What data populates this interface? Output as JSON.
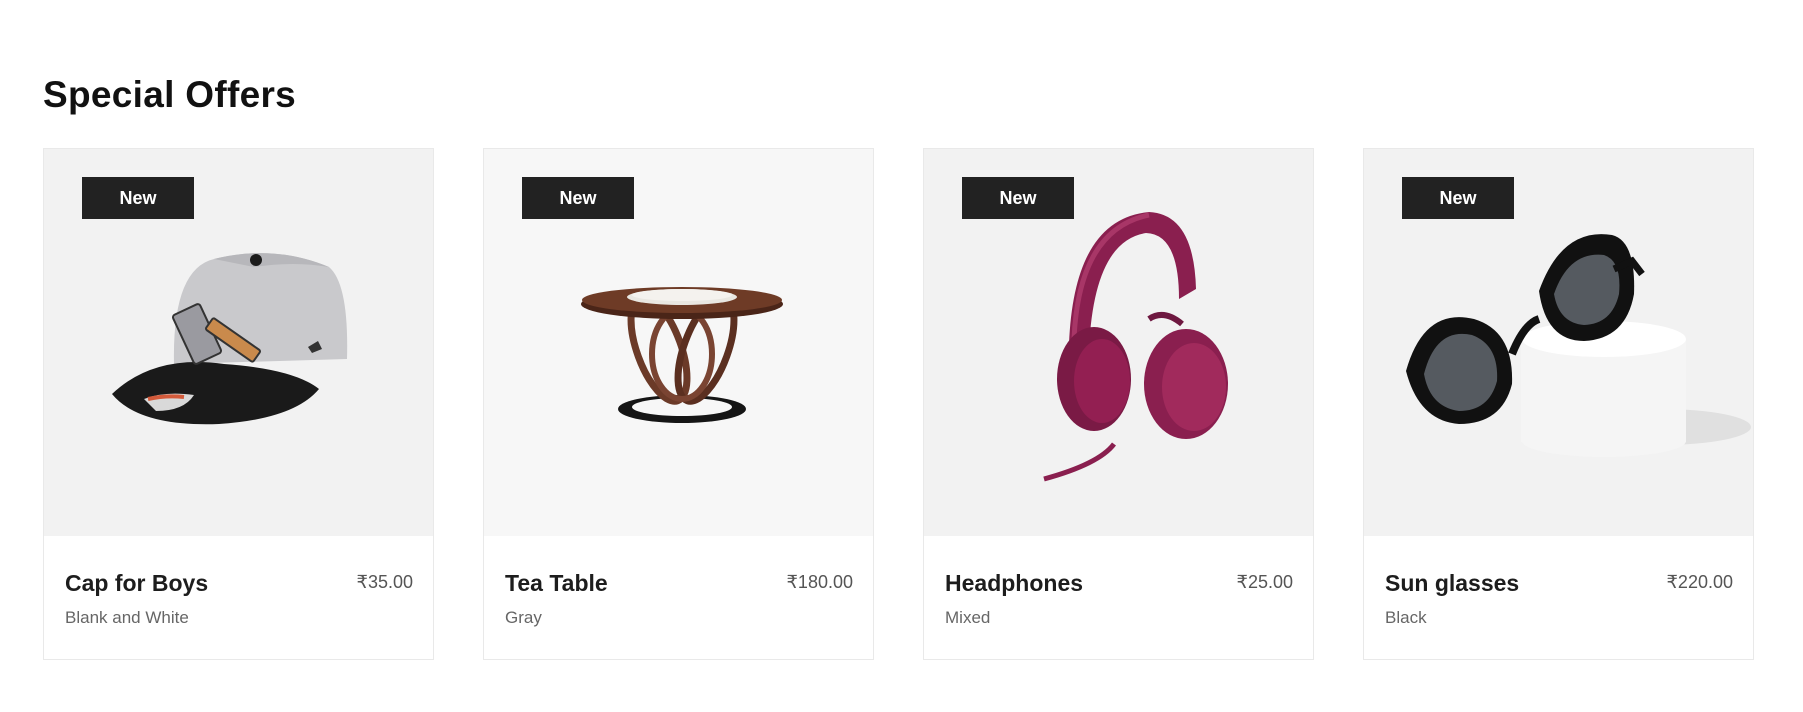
{
  "section": {
    "title": "Special Offers"
  },
  "products": [
    {
      "badge": "New",
      "name": "Cap for Boys",
      "price": "₹35.00",
      "variant": "Blank and White",
      "image_icon": "cap-image"
    },
    {
      "badge": "New",
      "name": "Tea Table",
      "price": "₹180.00",
      "variant": "Gray",
      "image_icon": "table-image"
    },
    {
      "badge": "New",
      "name": "Headphones",
      "price": "₹25.00",
      "variant": "Mixed",
      "image_icon": "headphones-image"
    },
    {
      "badge": "New",
      "name": "Sun glasses",
      "price": "₹220.00",
      "variant": "Black",
      "image_icon": "sunglasses-image"
    }
  ],
  "colors": {
    "badge_bg": "#222222",
    "card_media_bg": "#f2f2f2",
    "headphones": "#8a1f4f"
  }
}
